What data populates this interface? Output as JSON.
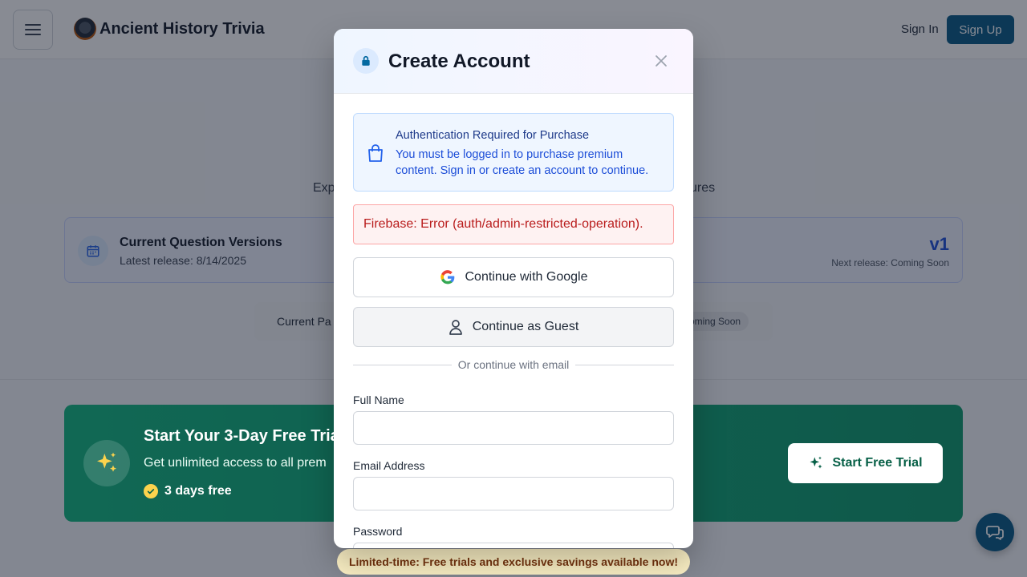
{
  "header": {
    "brand_title": "Ancient History Trivia",
    "signin_label": "Sign In",
    "signup_label": "Sign Up"
  },
  "background": {
    "subtitle_left_fragment": "Exp",
    "subtitle_right_fragment": "ures",
    "versions": {
      "title": "Current Question Versions",
      "latest_release": "Latest release: 8/14/2025",
      "version": "v1",
      "next_release": "Next release: Coming Soon"
    },
    "packs": {
      "label_fragment": "Current Pa",
      "badge_fragment": "oming Soon"
    },
    "trial": {
      "title": "Start Your 3-Day Free Tria",
      "subtitle": "Get unlimited access to all prem",
      "days_label": "3 days free",
      "button_label": "Start Free Trial"
    },
    "promo": "Limited-time: Free trials and exclusive savings available now!"
  },
  "modal": {
    "title": "Create Account",
    "auth_alert": {
      "title": "Authentication Required for Purchase",
      "text": "You must be logged in to purchase premium content. Sign in or create an account to continue."
    },
    "error": "Firebase: Error (auth/admin-restricted-operation).",
    "google_label": "Continue with Google",
    "guest_label": "Continue as Guest",
    "divider": "Or continue with email",
    "fields": {
      "name_label": "Full Name",
      "name_value": "",
      "email_label": "Email Address",
      "email_value": "",
      "password_label": "Password",
      "password_value": ""
    }
  },
  "icons": {
    "menu": "hamburger-icon",
    "lock": "lock-icon",
    "close": "close-icon",
    "bag": "shopping-bag-icon",
    "google": "google-icon",
    "user": "user-icon",
    "calendar": "calendar-icon",
    "sparkles": "sparkles-icon",
    "check": "check-circle-icon",
    "chat": "chat-icon"
  },
  "colors": {
    "primary": "#075985",
    "trial_green": "#10b981",
    "error_red": "#b91c1c",
    "info_blue": "#1d4ed8"
  }
}
